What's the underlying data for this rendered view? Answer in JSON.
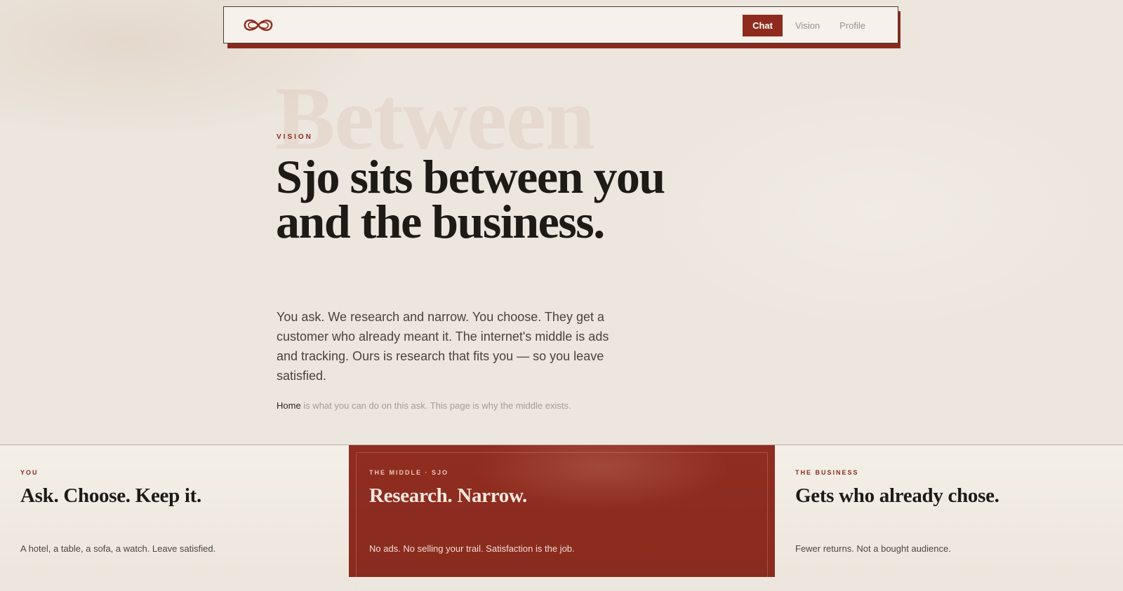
{
  "nav": {
    "logo_icon": "infinity-logo-icon",
    "links": [
      {
        "label": "Chat",
        "active": true
      },
      {
        "label": "Vision",
        "active": false
      },
      {
        "label": "Profile",
        "active": false
      }
    ]
  },
  "hero": {
    "background_word": "Between",
    "eyebrow": "VISION",
    "headline": "Sjo sits between you and the business.",
    "lede": "You ask. We research and narrow. You choose. They get a customer who already meant it. The internet's middle is ads and tracking. Ours is research that fits you — so you leave satisfied.",
    "note_link": "Home",
    "note_text": " is what you can do on this ask. This page is why the middle exists."
  },
  "cards": [
    {
      "label": "YOU",
      "title": "Ask. Choose. Keep it.",
      "body": "A hotel, a table, a sofa, a watch. Leave satisfied."
    },
    {
      "label": "THE MIDDLE · SJO",
      "title": "Research. Narrow.",
      "body": "No ads. No selling your trail. Satisfaction is the job."
    },
    {
      "label": "THE BUSINESS",
      "title": "Gets who already chose.",
      "body": "Fewer returns. Not a bought audience."
    }
  ],
  "colors": {
    "accent": "#8f2a1e",
    "background": "#ece6de",
    "text": "#1e1b17"
  }
}
